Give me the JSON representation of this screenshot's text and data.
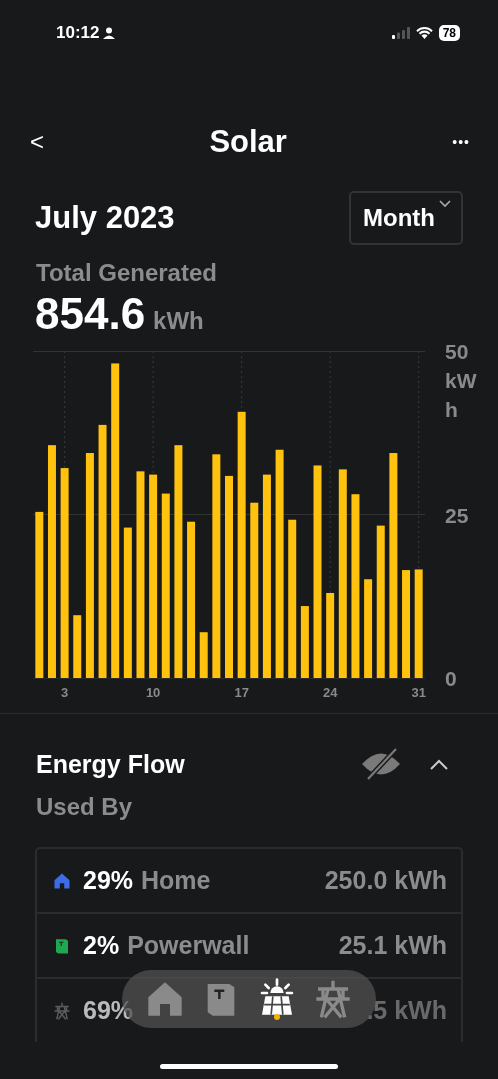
{
  "status_bar": {
    "time": "10:12",
    "battery": "78"
  },
  "header": {
    "back": "<",
    "title": "Solar",
    "more": "•••"
  },
  "period": {
    "label": "July 2023",
    "dropdown": "Month"
  },
  "summary": {
    "label": "Total Generated",
    "value": "854.6",
    "unit": "kWh"
  },
  "chart": {
    "chart_data": {
      "type": "bar",
      "ylabel": "kWh",
      "x": [
        1,
        2,
        3,
        4,
        5,
        6,
        7,
        8,
        9,
        10,
        11,
        12,
        13,
        14,
        15,
        16,
        17,
        18,
        19,
        20,
        21,
        22,
        23,
        24,
        25,
        26,
        27,
        28,
        29,
        30,
        31
      ],
      "series": [
        {
          "color": "#ffc20e",
          "values": [
            25.4,
            35.6,
            32.1,
            9.6,
            34.4,
            38.7,
            48.1,
            23.0,
            31.6,
            31.1,
            28.2,
            35.6,
            23.9,
            7.0,
            34.2,
            30.9,
            40.7,
            26.8,
            31.1,
            34.9,
            24.2,
            11.0,
            32.5,
            13.0,
            31.9,
            28.1,
            15.1,
            23.3,
            34.4,
            16.5,
            16.6
          ]
        }
      ],
      "grid": true,
      "ref_lines": [
        {
          "axis": "y",
          "value": 25
        }
      ],
      "xlim": [
        0.5,
        31.5
      ],
      "ylim": [
        0,
        50
      ],
      "xticks": [
        3,
        10,
        17,
        24,
        31
      ],
      "yticks": [
        0,
        25,
        50
      ]
    }
  },
  "energy_flow": {
    "title": "Energy Flow",
    "subtitle": "Used By",
    "rows": [
      {
        "kind": "home",
        "percent": "29%",
        "name": "Home",
        "value": "250.0 kWh"
      },
      {
        "kind": "powerwall",
        "percent": "2%",
        "name": "Powerwall",
        "value": "25.1 kWh"
      },
      {
        "kind": "grid",
        "percent": "69%",
        "value": ".5 kWh"
      }
    ]
  },
  "tab_bar": {
    "items": [
      {
        "kind": "home",
        "selected": false
      },
      {
        "kind": "powerwall",
        "selected": false
      },
      {
        "kind": "solar",
        "selected": true
      },
      {
        "kind": "grid",
        "selected": false
      }
    ]
  }
}
